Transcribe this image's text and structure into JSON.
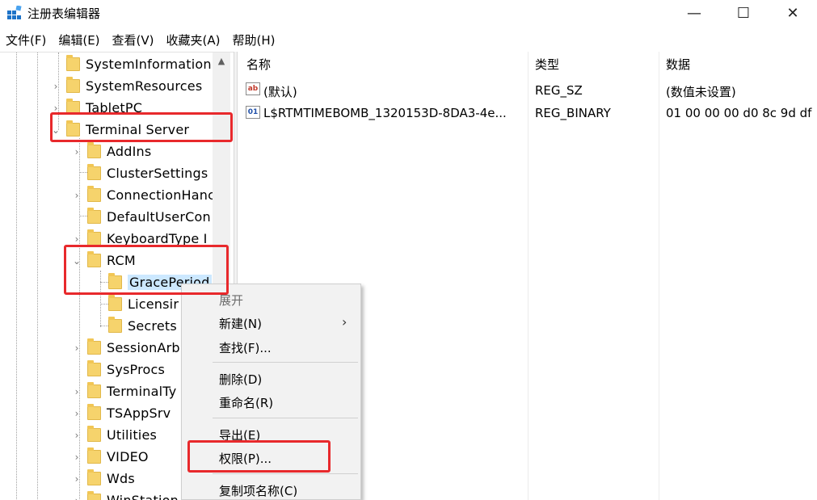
{
  "window": {
    "title": "注册表编辑器",
    "minimize_glyph": "—",
    "maximize_glyph": "☐",
    "close_glyph": "✕"
  },
  "menu": [
    "文件(F)",
    "编辑(E)",
    "查看(V)",
    "收藏夹(A)",
    "帮助(H)"
  ],
  "tree": {
    "items": [
      {
        "label": "SystemInformation",
        "expander": ""
      },
      {
        "label": "SystemResources",
        "expander": "›"
      },
      {
        "label": "TabletPC",
        "expander": "›"
      },
      {
        "label": "Terminal Server",
        "expander": "⌄"
      },
      {
        "label": "AddIns",
        "expander": "›"
      },
      {
        "label": "ClusterSettings",
        "expander": ""
      },
      {
        "label": "ConnectionHanc",
        "expander": "›"
      },
      {
        "label": "DefaultUserCon",
        "expander": ""
      },
      {
        "label": "KeyboardType I",
        "expander": "›"
      },
      {
        "label": "RCM",
        "expander": "⌄"
      },
      {
        "label": "GracePeriod",
        "expander": ""
      },
      {
        "label": "Licensir",
        "expander": ""
      },
      {
        "label": "Secrets",
        "expander": ""
      },
      {
        "label": "SessionArb",
        "expander": "›"
      },
      {
        "label": "SysProcs",
        "expander": ""
      },
      {
        "label": "TerminalTy",
        "expander": "›"
      },
      {
        "label": "TSAppSrv",
        "expander": "›"
      },
      {
        "label": "Utilities",
        "expander": "›"
      },
      {
        "label": "VIDEO",
        "expander": "›"
      },
      {
        "label": "Wds",
        "expander": "›"
      },
      {
        "label": "WinStation",
        "expander": "›"
      }
    ]
  },
  "list": {
    "headers": {
      "name": "名称",
      "type": "类型",
      "data": "数据"
    },
    "rows": [
      {
        "icon": "ab",
        "name": "(默认)",
        "type": "REG_SZ",
        "data": "(数值未设置)"
      },
      {
        "icon": "01",
        "name": "L$RTMTIMEBOMB_1320153D-8DA3-4e...",
        "type": "REG_BINARY",
        "data": "01 00 00 00 d0 8c 9d df"
      }
    ]
  },
  "context_menu": {
    "expand": "展开",
    "new": "新建(N)",
    "find": "查找(F)...",
    "delete": "删除(D)",
    "rename": "重命名(R)",
    "export": "导出(E)",
    "permissions": "权限(P)...",
    "copy_key_name": "复制项名称(C)",
    "submenu_arrow": "›"
  },
  "colors": {
    "highlight": "#e8292c",
    "selection": "#cce8ff",
    "folder": "#f6d36c"
  }
}
